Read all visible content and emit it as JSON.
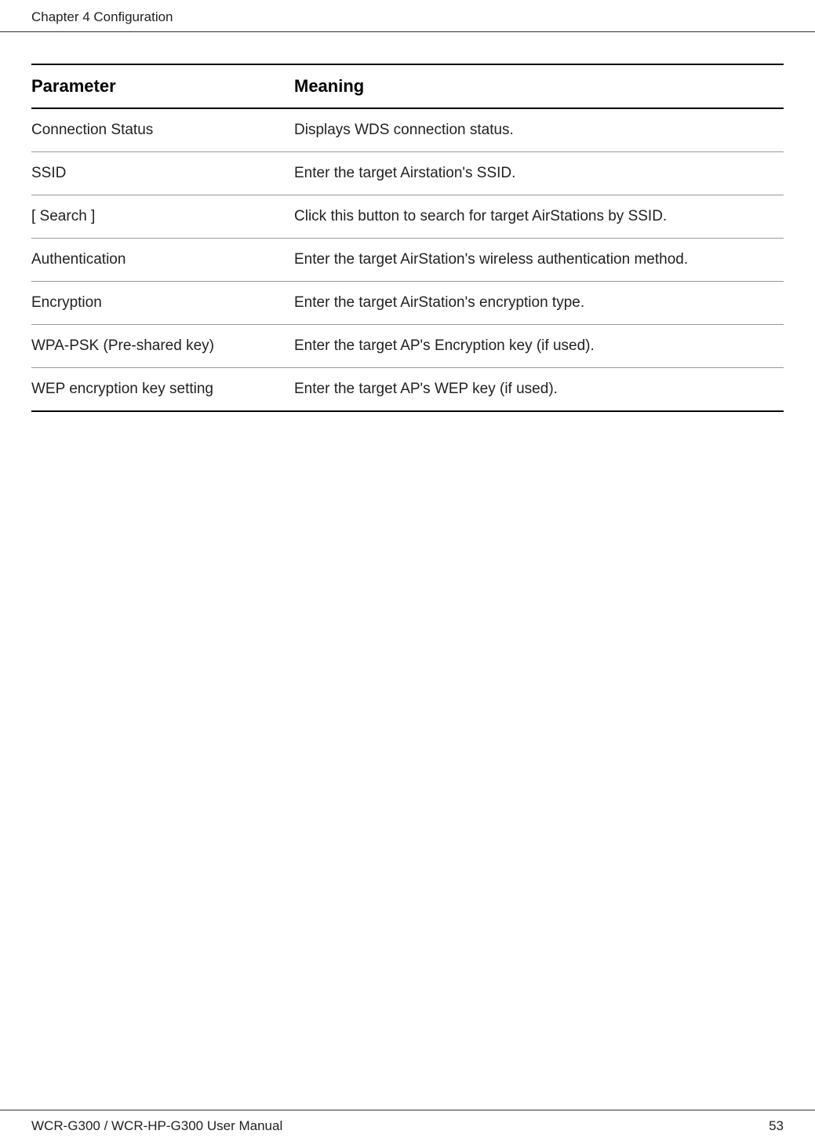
{
  "header": {
    "chapter_label": "Chapter 4  Configuration"
  },
  "table": {
    "columns": {
      "parameter": "Parameter",
      "meaning": "Meaning"
    },
    "rows": [
      {
        "parameter": "Connection Status",
        "meaning": "Displays WDS connection status."
      },
      {
        "parameter": "SSID",
        "meaning": "Enter the target Airstation's SSID."
      },
      {
        "parameter": "[ Search ]",
        "meaning": "Click this button to search for target AirStations by SSID."
      },
      {
        "parameter": "Authentication",
        "meaning": "Enter the target AirStation's wireless authentication method."
      },
      {
        "parameter": "Encryption",
        "meaning": "Enter the target AirStation's encryption type."
      },
      {
        "parameter": "WPA-PSK (Pre-shared key)",
        "meaning": "Enter the target AP's Encryption key (if used)."
      },
      {
        "parameter": "WEP encryption key setting",
        "meaning": "Enter the target AP's WEP key (if used)."
      }
    ]
  },
  "footer": {
    "manual_title": "WCR-G300 / WCR-HP-G300 User Manual",
    "page_number": "53"
  }
}
